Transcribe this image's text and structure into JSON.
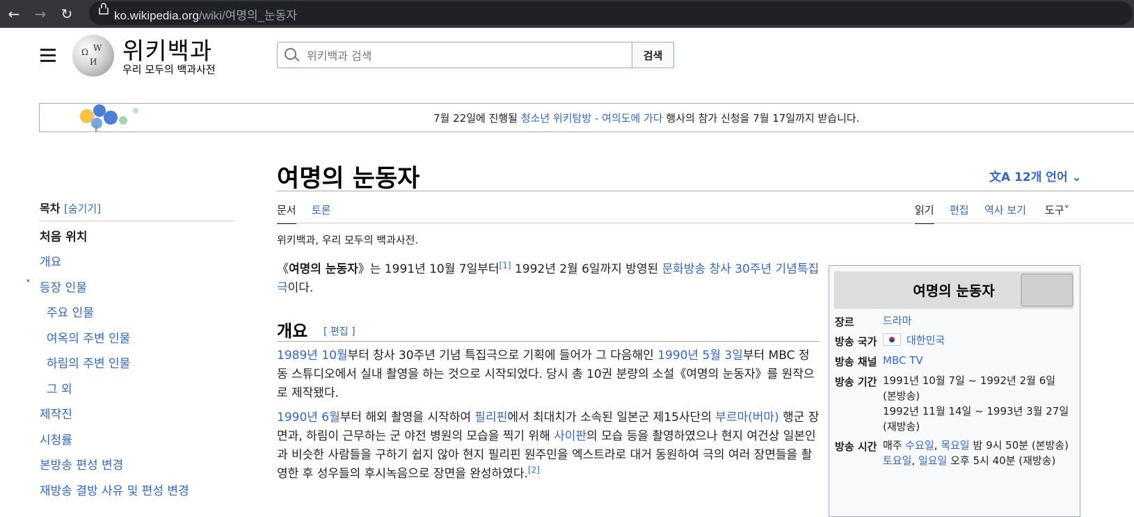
{
  "browser": {
    "url_host": "ko.wikipedia.org",
    "url_path": "/wiki/여명의_눈동자"
  },
  "header": {
    "wordmark": "위키백과",
    "tagline": "우리 모두의 백과사전",
    "search_placeholder": "위키백과 검색",
    "search_button": "검색"
  },
  "banner": {
    "pre": "7월 22일에 진행될 ",
    "link": "청소년 위키탐방 - 여의도에 가다",
    "post": " 행사의 참가 신청을 7월 17일까지 받습니다."
  },
  "toc": {
    "title": "목차",
    "hide_label": "[숨기기]",
    "items": [
      {
        "label": "처음 위치"
      },
      {
        "label": "개요"
      },
      {
        "label": "등장 인물"
      },
      {
        "label": "주요 인물"
      },
      {
        "label": "여옥의 주변 인물"
      },
      {
        "label": "하림의 주변 인물"
      },
      {
        "label": "그 외"
      },
      {
        "label": "제작진"
      },
      {
        "label": "시청률"
      },
      {
        "label": "본방송 편성 변경"
      },
      {
        "label": "재방송 결방 사유 및 편성 변경"
      }
    ]
  },
  "article": {
    "title": "여명의 눈동자",
    "languages": "12개 언어",
    "tabs": {
      "article": "문서",
      "talk": "토론",
      "read": "읽기",
      "edit": "편집",
      "history": "역사 보기",
      "tools": "도구"
    },
    "sitesub": "위키백과, 우리 모두의 백과사전.",
    "lead": {
      "open": "《",
      "bold": "여명의 눈동자",
      "mid": "》는 1991년 10월 7일부터",
      "ref1": "[1]",
      "mid2": " 1992년 2월 6일까지 방영된 ",
      "link": "문화방송 창사 30주년 기념특집극",
      "end": "이다."
    },
    "section": {
      "title": "개요",
      "edit": "[ 편집 ]"
    },
    "p1": {
      "link1": "1989년 10월",
      "t1": "부터 창사 30주년 기념 특집극으로 기획에 들어가 그 다음해인 ",
      "link2": "1990년 5월 3일",
      "t2": "부터 MBC 정동 스튜디오에서 실내 촬영을 하는 것으로 시작되었다. 당시 총 10권 분량의 소설《여명의 눈동자》를 원작으로 제작됐다."
    },
    "p2": {
      "link1": "1990년 6월",
      "t1": "부터 해외 촬영을 시작하여 ",
      "link2": "필리핀",
      "t2": "에서 최대치가 소속된 일본군 제15사단의 ",
      "link3": "부르마(버마)",
      "t3": " 행군 장면과, 하림이 근무하는 군 야전 병원의 모습을 찍기 위해 ",
      "link4": "사이판",
      "t4": "의 모습 등을 촬영하였으나 현지 여건상 일본인과 비슷한 사람들을 구하기 쉽지 않아 현지 필리핀 원주민을 엑스트라로 대거 동원하여 극의 여러 장면들을 촬영한 후 성우들의 후시녹음으로 장면을 완성하였다.",
      "ref": "[2]"
    }
  },
  "infobox": {
    "title": "여명의 눈동자",
    "rows": [
      {
        "label": "장르",
        "value": "드라마"
      },
      {
        "label": "방송 국가",
        "value": "대한민국"
      },
      {
        "label": "방송 채널",
        "value": "MBC TV"
      },
      {
        "label": "방송 기간",
        "value1": "1991년 10월 7일 ~ 1992년 2월 6일 (본방송)",
        "value2": "1992년 11월 14일 ~ 1993년 3월 27일 (재방송)"
      },
      {
        "label": "방송 시간",
        "d1": "수요일",
        "sep": ", ",
        "d2": "목요일",
        "t1": " 밤 9시 50분 (본방송)",
        "d3": "토요일",
        "d4": "일요일",
        "t2": " 오후 5시 40분 (재방송)",
        "lead": "매주 "
      }
    ]
  },
  "colors": {
    "link": "#3366cc",
    "text": "#202122",
    "browser_bar": "#35363a"
  }
}
